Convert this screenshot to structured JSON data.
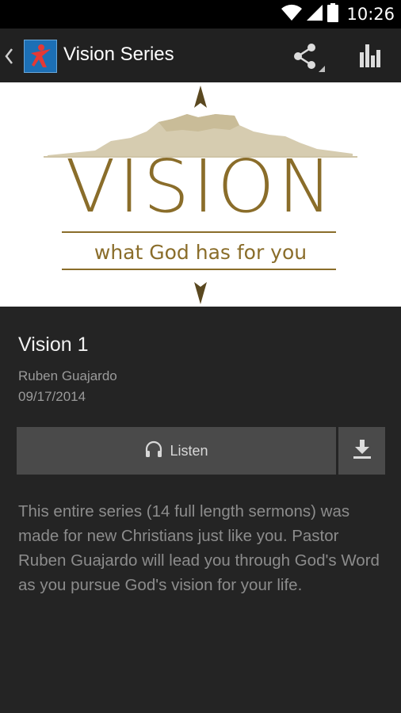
{
  "status_bar": {
    "time": "10:26",
    "icons": [
      "wifi-icon",
      "signal-icon",
      "battery-icon"
    ]
  },
  "action_bar": {
    "title": "Vision Series",
    "icons": [
      "back-chevron-icon",
      "app-logo",
      "share-icon",
      "stats-icon"
    ]
  },
  "banner": {
    "heading": "VISION",
    "tagline": "what God has for you",
    "accent_color": "#8a6d2a"
  },
  "sermon": {
    "title": "Vision 1",
    "speaker": "Ruben Guajardo",
    "date": "09/17/2014",
    "listen_label": "Listen",
    "description": "This entire series (14 full length sermons) was made for new Christians just like you.  Pastor Ruben Guajardo will lead you through God's Word as you pursue God's vision for your life."
  }
}
